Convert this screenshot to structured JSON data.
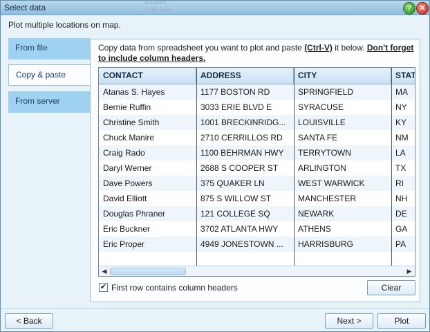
{
  "window": {
    "title": "Select data"
  },
  "watermark": {
    "line1": "Estates",
    "line2": "of Prairie"
  },
  "title_buttons": {
    "help": "?",
    "close": "✕"
  },
  "subtitle": "Plot multiple locations on map.",
  "tabs": [
    {
      "label": "From file",
      "active": false
    },
    {
      "label": "Copy & paste",
      "active": true
    },
    {
      "label": "From server",
      "active": false
    }
  ],
  "instructions": {
    "part1": "Copy data from spreadsheet you want to plot and paste ",
    "shortcut": "(Ctrl-V)",
    "part2": " it below. ",
    "warning": "Don't forget to include column headers."
  },
  "table": {
    "columns": [
      "CONTACT",
      "ADDRESS",
      "CITY",
      "STAT"
    ],
    "rows": [
      [
        "Atanas S. Hayes",
        "1177 BOSTON RD",
        "SPRINGFIELD",
        "MA"
      ],
      [
        "Bernie Ruffin",
        "3033 ERIE BLVD E",
        "SYRACUSE",
        "NY"
      ],
      [
        "Christine Smith",
        "1001 BRECKINRIDG...",
        "LOUISVILLE",
        "KY"
      ],
      [
        "Chuck Manire",
        "2710 CERRILLOS RD",
        "SANTA FE",
        "NM"
      ],
      [
        "Craig Rado",
        "1100 BEHRMAN HWY",
        "TERRYTOWN",
        "LA"
      ],
      [
        "Daryl Werner",
        "2688 S COOPER ST",
        "ARLINGTON",
        "TX"
      ],
      [
        "Dave Powers",
        "375 QUAKER LN",
        "WEST WARWICK",
        "RI"
      ],
      [
        "David Elliott",
        "875 S WILLOW ST",
        "MANCHESTER",
        "NH"
      ],
      [
        "Douglas Phraner",
        "121 COLLEGE SQ",
        "NEWARK",
        "DE"
      ],
      [
        "Eric Buckner",
        "3702 ATLANTA HWY",
        "ATHENS",
        "GA"
      ],
      [
        "Eric Proper",
        "4949 JONESTOWN ...",
        "HARRISBURG",
        "PA"
      ]
    ]
  },
  "scroll": {
    "left_arrow": "◀",
    "right_arrow": "▶"
  },
  "first_row_headers": {
    "label": "First row contains column headers",
    "checked": true,
    "mark": "✔"
  },
  "buttons": {
    "clear": "Clear",
    "back": "< Back",
    "next": "Next >",
    "plot": "Plot"
  },
  "colors": {
    "tab_inactive": "#9fd2f1",
    "panel_bg": "#fbfdff",
    "window_bg": "#e8f2f9"
  }
}
